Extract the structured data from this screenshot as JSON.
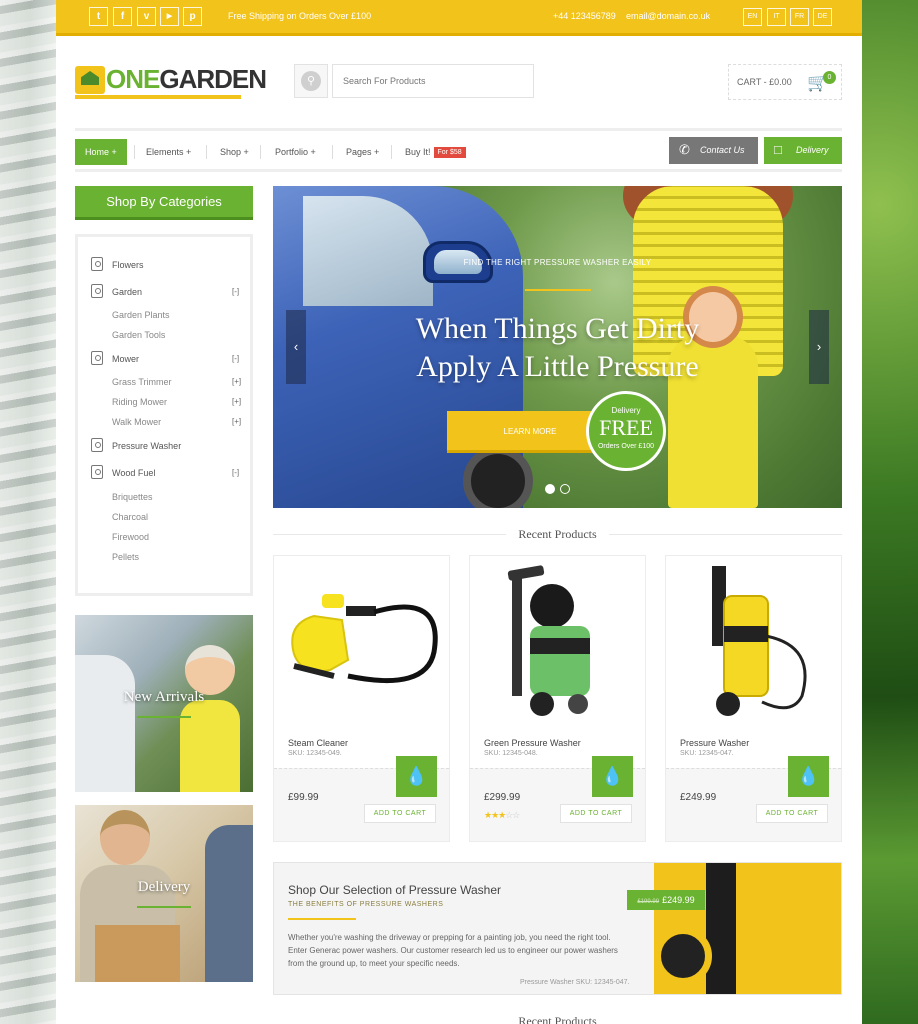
{
  "topbar": {
    "social": [
      {
        "name": "twitter-icon",
        "glyph": "t"
      },
      {
        "name": "facebook-icon",
        "glyph": "f"
      },
      {
        "name": "vimeo-icon",
        "glyph": "v"
      },
      {
        "name": "youtube-icon",
        "glyph": "▶"
      },
      {
        "name": "pinterest-icon",
        "glyph": "p"
      }
    ],
    "shipping": "Free Shipping on Orders Over £100",
    "phone": "+44 123456789",
    "email": "email@domain.co.uk",
    "languages": [
      "EN",
      "IT",
      "FR",
      "DE"
    ]
  },
  "header": {
    "logo_one": "ONE",
    "logo_garden": "GARDEN",
    "search_placeholder": "Search For Products",
    "cart_label": "CART - £0.00",
    "cart_count": "0"
  },
  "nav": {
    "items": [
      "Home +",
      "Elements +",
      "Shop +",
      "Portfolio +",
      "Pages +",
      "Buy It!"
    ],
    "buy_badge": "For $58",
    "contact": "Contact Us",
    "delivery": "Delivery"
  },
  "sidebar": {
    "heading": "Shop By Categories",
    "categories": [
      {
        "label": "Flowers"
      },
      {
        "label": "Garden",
        "toggle": "[-]",
        "subs": [
          "Garden Plants",
          "Garden Tools"
        ]
      },
      {
        "label": "Mower",
        "toggle": "[-]",
        "subs": [
          "Grass Trimmer",
          "Riding Mower",
          "Walk Mower"
        ],
        "sub_toggles": [
          "[+]",
          "[+]",
          "[+]"
        ]
      },
      {
        "label": "Pressure Washer"
      },
      {
        "label": "Wood Fuel",
        "toggle": "[-]",
        "subs": [
          "Briquettes",
          "Charcoal",
          "Firewood",
          "Pellets"
        ]
      }
    ],
    "banners": [
      "New Arrivals",
      "Delivery"
    ]
  },
  "slider": {
    "subtitle": "FIND THE RIGHT PRESSURE WASHER EASILY",
    "title_line1": "When Things Get Dirty",
    "title_line2": "Apply A Little Pressure",
    "button": "LEARN MORE",
    "badge_top": "Delivery",
    "badge_main": "FREE",
    "badge_bottom": "Orders Over £100",
    "active_slide": 1,
    "slide_count": 2
  },
  "recent": {
    "title": "Recent Products",
    "products": [
      {
        "name": "Steam Cleaner",
        "sku": "SKU: 12345-049.",
        "price": "£99.99",
        "cart": "ADD TO CART",
        "rating": null
      },
      {
        "name": "Green Pressure Washer",
        "sku": "SKU: 12345-048.",
        "price": "£299.99",
        "cart": "ADD TO CART",
        "rating": 3
      },
      {
        "name": "Pressure Washer",
        "sku": "SKU: 12345-047.",
        "price": "£249.99",
        "cart": "ADD TO CART",
        "rating": null
      }
    ]
  },
  "promo": {
    "title": "Shop Our Selection of Pressure Washer",
    "subtitle": "THE BENEFITS OF PRESSURE WASHERS",
    "text": "Whether you're washing the driveway or prepping for a painting job, you need the right tool. Enter Generac power washers. Our customer research led us to engineer our power washers from the ground up, to meet your specific needs.",
    "sku": "Pressure Washer SKU: 12345-047.",
    "old_price": "£199.99",
    "price": "£249.99"
  },
  "bottom_title": "Recent Products",
  "colors": {
    "accent_green": "#6ab231",
    "accent_yellow": "#f2c31b",
    "sale_red": "#e14a3c"
  }
}
